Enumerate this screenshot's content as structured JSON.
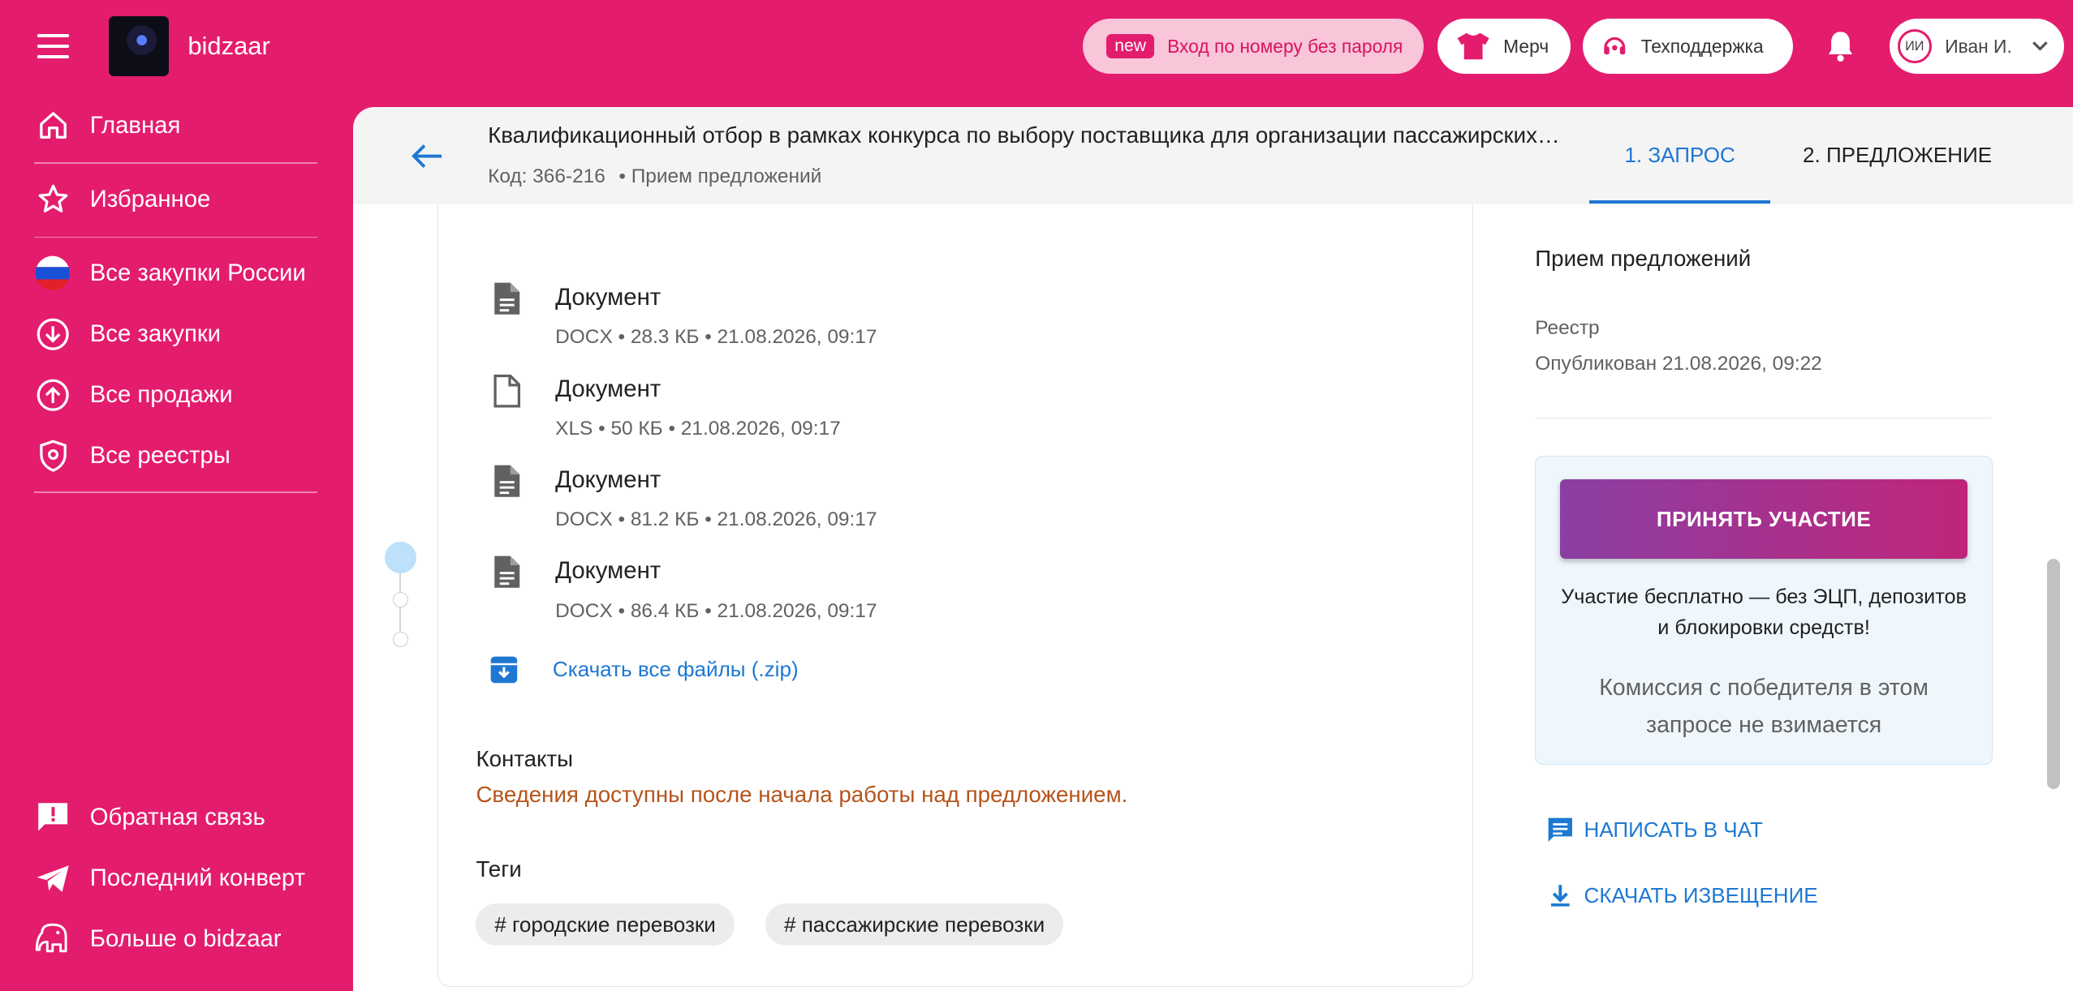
{
  "header": {
    "logo_text": "bidzaar",
    "login_badge": "new",
    "login_label": "Вход по номеру без пароля",
    "merch_label": "Мерч",
    "support_label": "Техподдержка",
    "user_initials": "ИИ",
    "user_name": "Иван И."
  },
  "sidebar": {
    "items": [
      {
        "label": "Главная",
        "icon": "home-icon"
      },
      {
        "label": "Избранное",
        "icon": "star-icon"
      },
      {
        "label": "Все закупки России",
        "icon": "russia-flag-icon"
      },
      {
        "label": "Все закупки",
        "icon": "arrow-down-circle-icon"
      },
      {
        "label": "Все продажи",
        "icon": "arrow-up-circle-icon"
      },
      {
        "label": "Все реестры",
        "icon": "shield-icon"
      }
    ],
    "bottom_items": [
      {
        "label": "Обратная связь",
        "icon": "feedback-icon"
      },
      {
        "label": "Последний конверт",
        "icon": "telegram-icon"
      },
      {
        "label": "Больше о bidzaar",
        "icon": "elephant-icon"
      }
    ]
  },
  "page": {
    "title": "Квалификационный отбор в рамках конкурса по выбору поставщика для организации пассажирских перевозок",
    "code": "Код: 366-216",
    "status": "• Прием предложений",
    "tabs": [
      "1. ЗАПРОС",
      "2. ПРЕДЛОЖЕНИЕ"
    ]
  },
  "documents": [
    {
      "name": "Документ",
      "meta": "DOCX • 28.3 КБ • 21.08.2026, 09:17"
    },
    {
      "name": "Документ",
      "meta": "XLS • 50 КБ • 21.08.2026, 09:17"
    },
    {
      "name": "Документ",
      "meta": "DOCX • 81.2 КБ • 21.08.2026, 09:17"
    },
    {
      "name": "Документ",
      "meta": "DOCX • 86.4 КБ • 21.08.2026, 09:17"
    }
  ],
  "download_all": "Скачать все файлы (.zip)",
  "contacts": {
    "heading": "Контакты",
    "note": "Сведения доступны после начала работы над предложением."
  },
  "tags": {
    "heading": "Теги",
    "items": [
      "# городские перевозки",
      "# пассажирские перевозки"
    ]
  },
  "right": {
    "status_title": "Прием предложений",
    "registry_label": "Реестр",
    "published": "Опубликован 21.08.2026, 09:22",
    "cta_label": "ПРИНЯТЬ УЧАСТИЕ",
    "free_note": "Участие бесплатно — без ЭЦП, депозитов и блокировки средств!",
    "commission": "Комиссия с победителя в этом запросе не взимается",
    "chat_label": "НАПИСАТЬ В ЧАТ",
    "notice_label": "СКАЧАТЬ ИЗВЕЩЕНИЕ"
  },
  "colors": {
    "brand": "#e41c6e",
    "accent": "#1e78d2",
    "warning_text": "#b5541b"
  }
}
